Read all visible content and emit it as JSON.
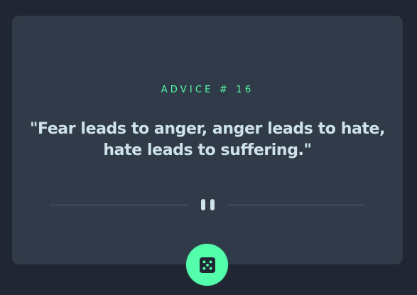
{
  "advice": {
    "heading": "ADVICE # 16",
    "quote": "\"Fear leads to anger, anger leads to hate, hate leads to suffering.\""
  },
  "icons": {
    "divider": "pause-icon",
    "button": "dice-icon"
  },
  "colors": {
    "background": "#202632",
    "card": "#313a48",
    "accent": "#53ffab",
    "text": "#cee3e9",
    "divider": "#4f5d74"
  }
}
